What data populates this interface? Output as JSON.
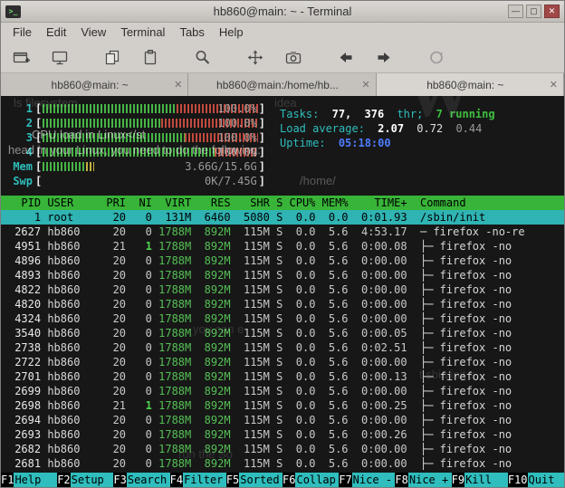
{
  "window": {
    "title": "hb860@main: ~ - Terminal"
  },
  "glyphs": {
    "terminal": ">_",
    "minimize": "—",
    "maximize": "▢",
    "close": "✕"
  },
  "menu": {
    "items": [
      "File",
      "Edit",
      "View",
      "Terminal",
      "Tabs",
      "Help"
    ]
  },
  "toolbar": {
    "icons": [
      "new-tab",
      "new-window",
      "copy",
      "paste",
      "search",
      "fullscreen",
      "screenshot",
      "back",
      "forward",
      "reload"
    ]
  },
  "tabs": [
    {
      "label": "hb860@main: ~"
    },
    {
      "label": "hb860@main:/home/hb..."
    },
    {
      "label": "hb860@main: ~"
    }
  ],
  "htop": {
    "meters": {
      "bl": "[",
      "br": "]",
      "cpus": [
        {
          "label": "1",
          "pct": "100.0%",
          "green": 62,
          "red": 38
        },
        {
          "label": "2",
          "pct": "100.0%",
          "green": 55,
          "red": 45
        },
        {
          "label": "3",
          "pct": "100.0%",
          "green": 66,
          "red": 34
        },
        {
          "label": "4",
          "pct": "100.0%",
          "green": 80,
          "red": 20
        }
      ],
      "mem": {
        "label": "Mem",
        "value": "3.66G/15.6G",
        "green": 20,
        "yellow": 4
      },
      "swp": {
        "label": "Swp",
        "value": "0K/7.45G"
      }
    },
    "summary": {
      "tasks_label": "Tasks:",
      "tasks_count": "77,",
      "thr_count": "376",
      "thr_label": "thr;",
      "running": "7 running",
      "load_label": "Load average:",
      "load1": "2.07",
      "load5": "0.72",
      "load15": "0.44",
      "uptime_label": "Uptime:",
      "uptime_value": "05:18:00"
    },
    "columns": [
      "PID",
      "USER",
      "PRI",
      "NI",
      "VIRT",
      "RES",
      "SHR",
      "S",
      "CPU%",
      "MEM%",
      "TIME+",
      "Command"
    ],
    "selected_row": {
      "pid": "1",
      "user": "root",
      "pri": "20",
      "ni": "0",
      "virt": "131M",
      "res": "6460",
      "shr": "5080",
      "s": "S",
      "cpu": "0.0",
      "mem": "0.0",
      "time": "0:01.93",
      "cmd": "/sbin/init"
    },
    "rows": [
      {
        "pid": "2627",
        "user": "hb860",
        "pri": "20",
        "ni": "0",
        "virt": "1788M",
        "res": "892M",
        "shr": "115M",
        "s": "S",
        "cpu": "0.0",
        "mem": "5.6",
        "time": "4:53.17",
        "cmd": "─ firefox -no-re"
      },
      {
        "pid": "4951",
        "user": "hb860",
        "pri": "21",
        "ni": "1",
        "virt": "1788M",
        "res": "892M",
        "shr": "115M",
        "s": "S",
        "cpu": "0.0",
        "mem": "5.6",
        "time": "0:00.08",
        "cmd": "├─ firefox -no"
      },
      {
        "pid": "4896",
        "user": "hb860",
        "pri": "20",
        "ni": "0",
        "virt": "1788M",
        "res": "892M",
        "shr": "115M",
        "s": "S",
        "cpu": "0.0",
        "mem": "5.6",
        "time": "0:00.00",
        "cmd": "├─ firefox -no"
      },
      {
        "pid": "4893",
        "user": "hb860",
        "pri": "20",
        "ni": "0",
        "virt": "1788M",
        "res": "892M",
        "shr": "115M",
        "s": "S",
        "cpu": "0.0",
        "mem": "5.6",
        "time": "0:00.00",
        "cmd": "├─ firefox -no"
      },
      {
        "pid": "4822",
        "user": "hb860",
        "pri": "20",
        "ni": "0",
        "virt": "1788M",
        "res": "892M",
        "shr": "115M",
        "s": "S",
        "cpu": "0.0",
        "mem": "5.6",
        "time": "0:00.00",
        "cmd": "├─ firefox -no"
      },
      {
        "pid": "4820",
        "user": "hb860",
        "pri": "20",
        "ni": "0",
        "virt": "1788M",
        "res": "892M",
        "shr": "115M",
        "s": "S",
        "cpu": "0.0",
        "mem": "5.6",
        "time": "0:00.00",
        "cmd": "├─ firefox -no"
      },
      {
        "pid": "4324",
        "user": "hb860",
        "pri": "20",
        "ni": "0",
        "virt": "1788M",
        "res": "892M",
        "shr": "115M",
        "s": "S",
        "cpu": "0.0",
        "mem": "5.6",
        "time": "0:00.00",
        "cmd": "├─ firefox -no"
      },
      {
        "pid": "3540",
        "user": "hb860",
        "pri": "20",
        "ni": "0",
        "virt": "1788M",
        "res": "892M",
        "shr": "115M",
        "s": "S",
        "cpu": "0.0",
        "mem": "5.6",
        "time": "0:00.05",
        "cmd": "├─ firefox -no"
      },
      {
        "pid": "2738",
        "user": "hb860",
        "pri": "20",
        "ni": "0",
        "virt": "1788M",
        "res": "892M",
        "shr": "115M",
        "s": "S",
        "cpu": "0.0",
        "mem": "5.6",
        "time": "0:02.51",
        "cmd": "├─ firefox -no"
      },
      {
        "pid": "2722",
        "user": "hb860",
        "pri": "20",
        "ni": "0",
        "virt": "1788M",
        "res": "892M",
        "shr": "115M",
        "s": "S",
        "cpu": "0.0",
        "mem": "5.6",
        "time": "0:00.00",
        "cmd": "├─ firefox -no"
      },
      {
        "pid": "2701",
        "user": "hb860",
        "pri": "20",
        "ni": "0",
        "virt": "1788M",
        "res": "892M",
        "shr": "115M",
        "s": "S",
        "cpu": "0.0",
        "mem": "5.6",
        "time": "0:00.13",
        "cmd": "├─ firefox -no"
      },
      {
        "pid": "2699",
        "user": "hb860",
        "pri": "20",
        "ni": "0",
        "virt": "1788M",
        "res": "892M",
        "shr": "115M",
        "s": "S",
        "cpu": "0.0",
        "mem": "5.6",
        "time": "0:00.00",
        "cmd": "├─ firefox -no"
      },
      {
        "pid": "2698",
        "user": "hb860",
        "pri": "21",
        "ni": "1",
        "virt": "1788M",
        "res": "892M",
        "shr": "115M",
        "s": "S",
        "cpu": "0.0",
        "mem": "5.6",
        "time": "0:00.25",
        "cmd": "├─ firefox -no"
      },
      {
        "pid": "2694",
        "user": "hb860",
        "pri": "20",
        "ni": "0",
        "virt": "1788M",
        "res": "892M",
        "shr": "115M",
        "s": "S",
        "cpu": "0.0",
        "mem": "5.6",
        "time": "0:00.00",
        "cmd": "├─ firefox -no"
      },
      {
        "pid": "2693",
        "user": "hb860",
        "pri": "20",
        "ni": "0",
        "virt": "1788M",
        "res": "892M",
        "shr": "115M",
        "s": "S",
        "cpu": "0.0",
        "mem": "5.6",
        "time": "0:00.26",
        "cmd": "├─ firefox -no"
      },
      {
        "pid": "2682",
        "user": "hb860",
        "pri": "20",
        "ni": "0",
        "virt": "1788M",
        "res": "892M",
        "shr": "115M",
        "s": "S",
        "cpu": "0.0",
        "mem": "5.6",
        "time": "0:00.00",
        "cmd": "├─ firefox -no"
      },
      {
        "pid": "2681",
        "user": "hb860",
        "pri": "20",
        "ni": "0",
        "virt": "1788M",
        "res": "892M",
        "shr": "115M",
        "s": "S",
        "cpu": "0.0",
        "mem": "5.6",
        "time": "0:00.00",
        "cmd": "├─ firefox -no"
      }
    ],
    "fkeys": [
      {
        "key": "F1",
        "label": "Help"
      },
      {
        "key": "F2",
        "label": "Setup"
      },
      {
        "key": "F3",
        "label": "Search"
      },
      {
        "key": "F4",
        "label": "Filter"
      },
      {
        "key": "F5",
        "label": "Sorted"
      },
      {
        "key": "F6",
        "label": "Collap"
      },
      {
        "key": "F7",
        "label": "Nice -"
      },
      {
        "key": "F8",
        "label": "Nice +"
      },
      {
        "key": "F9",
        "label": "Kill"
      },
      {
        "key": "F10",
        "label": "Quit"
      }
    ]
  },
  "ghost": [
    "ls filesystem",
    "CPU load in Linux</st",
    "head in your Linux, you need to do the following:",
    "/home/",
    "W",
    "idea",
    "you can e",
    "run the So",
    "t sbin/init s"
  ]
}
